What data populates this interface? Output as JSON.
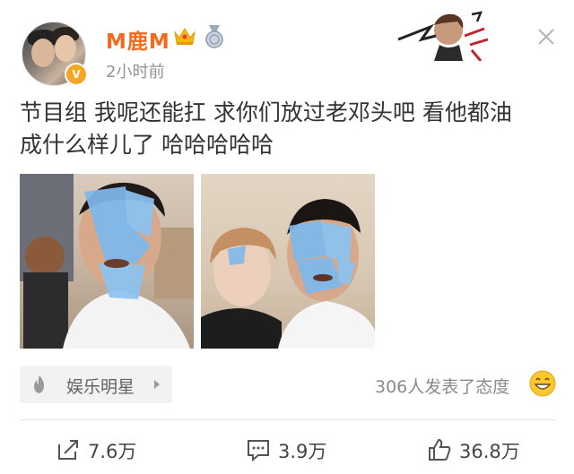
{
  "post": {
    "username": "M鹿M",
    "timestamp": "2小时前",
    "verified_badge": "V",
    "text_line1": "节目组 我呢还能扛 求你们放过老邓头吧 看他都油",
    "text_line2": "成什么样儿了 哈哈哈哈哈"
  },
  "tag": {
    "label": "娱乐明星",
    "icon": "flame-icon"
  },
  "reactions": {
    "text": "306人发表了态度",
    "emoji": "grin-emoji-icon"
  },
  "actions": {
    "share_count": "7.6万",
    "comment_count": "3.9万",
    "like_count": "36.8万"
  },
  "colors": {
    "username": "#f36a1d",
    "badge": "#f5a623",
    "pad": "#7fb8ec"
  }
}
